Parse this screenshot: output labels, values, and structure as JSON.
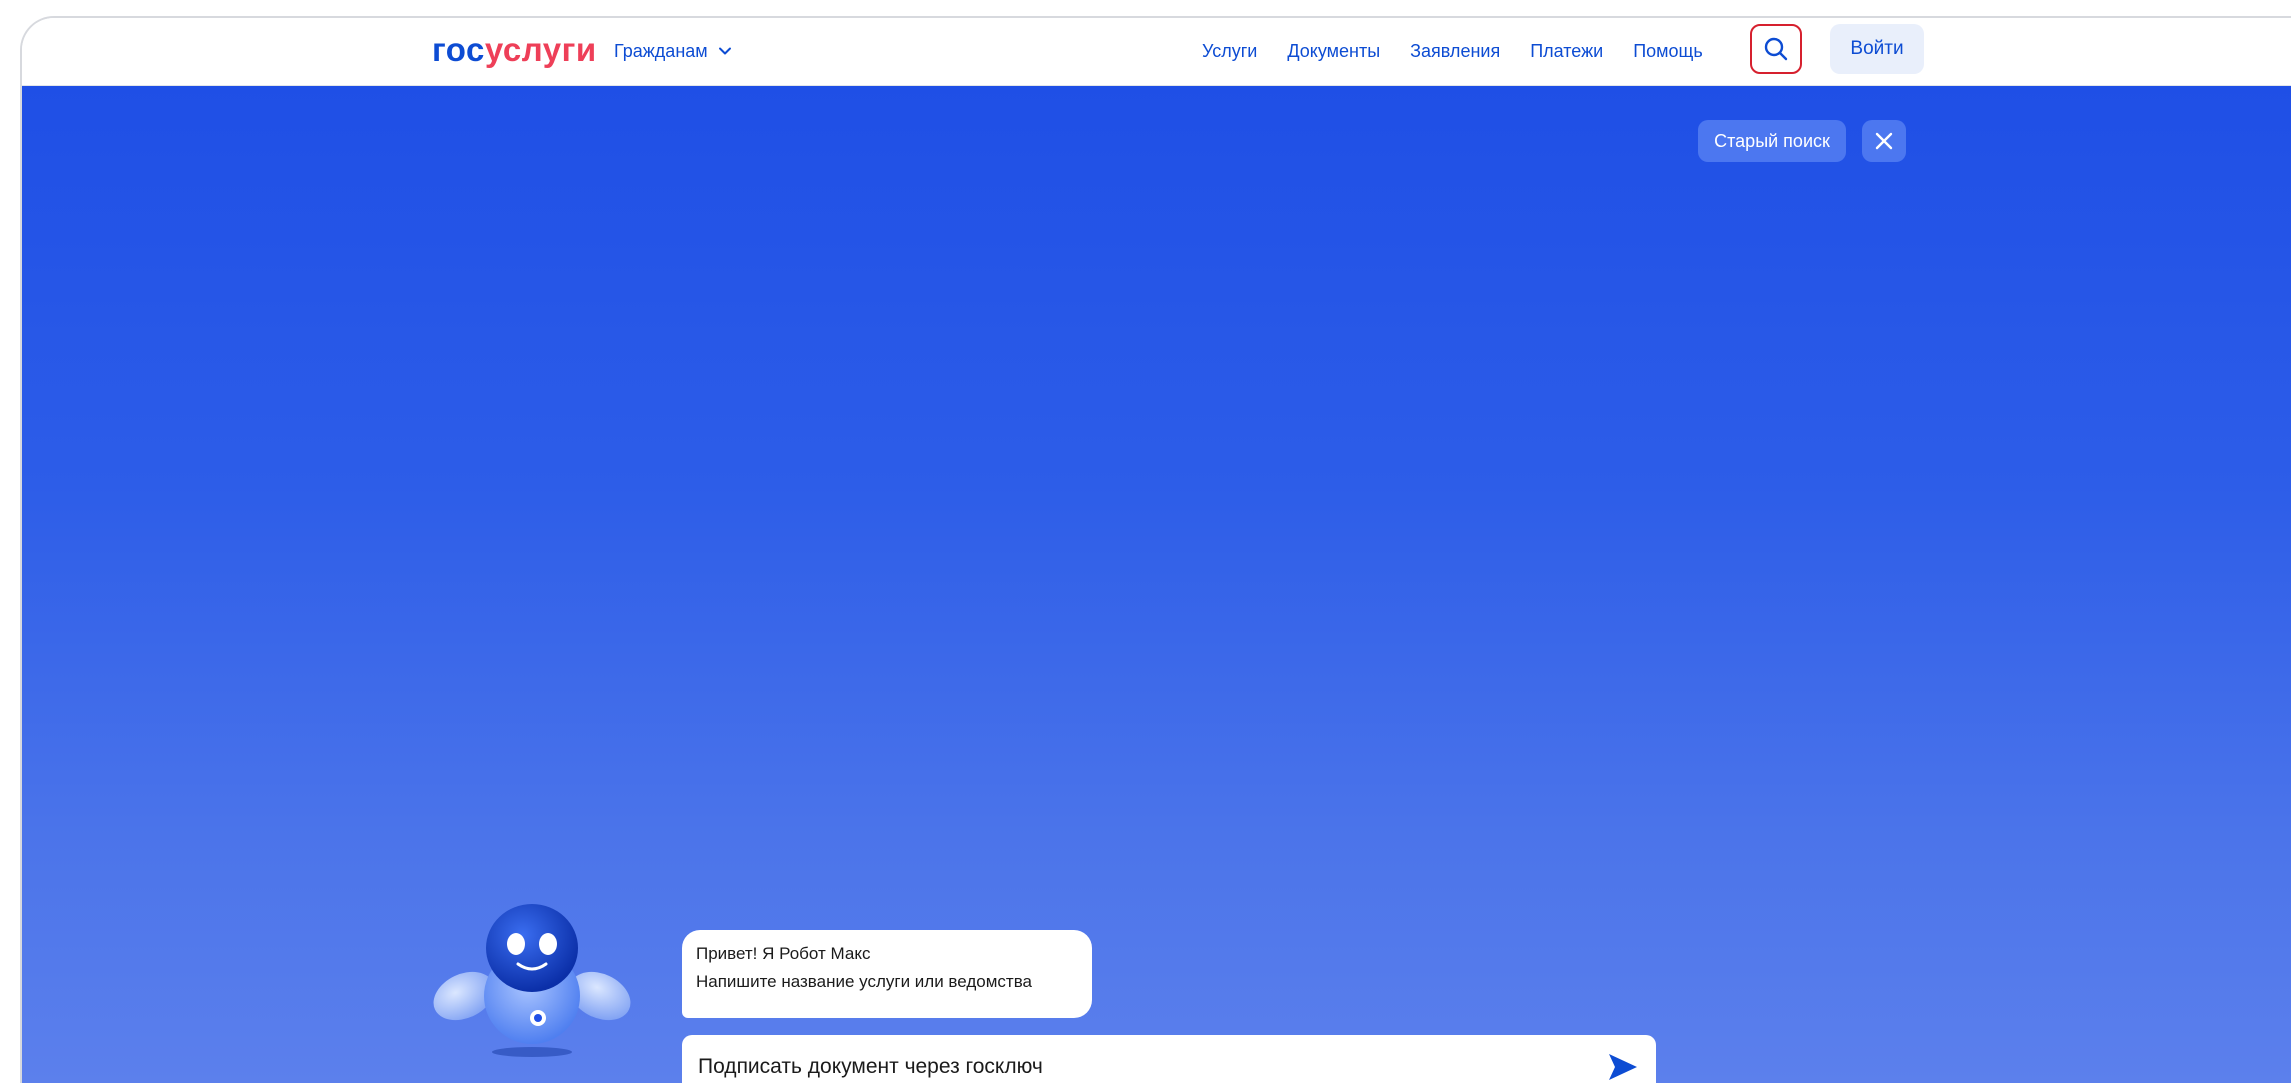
{
  "header": {
    "logo_part1": "гос",
    "logo_part2": "услуги",
    "citizens_label": "Гражданам",
    "nav": [
      "Услуги",
      "Документы",
      "Заявления",
      "Платежи",
      "Помощь"
    ],
    "login_label": "Войти"
  },
  "hero": {
    "old_search_label": "Старый поиск"
  },
  "chat": {
    "greeting": "Привет! Я Робот Макс",
    "prompt": "Напишите название услуги или ведомства",
    "input_value": "Подписать документ через госключ"
  },
  "colors": {
    "brand_blue": "#0d4cd3",
    "brand_red": "#ee3f58",
    "hero_top": "#1f4fe6",
    "hero_bottom": "#5c80ec",
    "search_highlight": "#d6202e"
  },
  "icons": {
    "search": "search-icon",
    "chevron": "chevron-down-icon",
    "close": "close-icon",
    "send": "send-icon",
    "robot": "robot-max-avatar"
  }
}
